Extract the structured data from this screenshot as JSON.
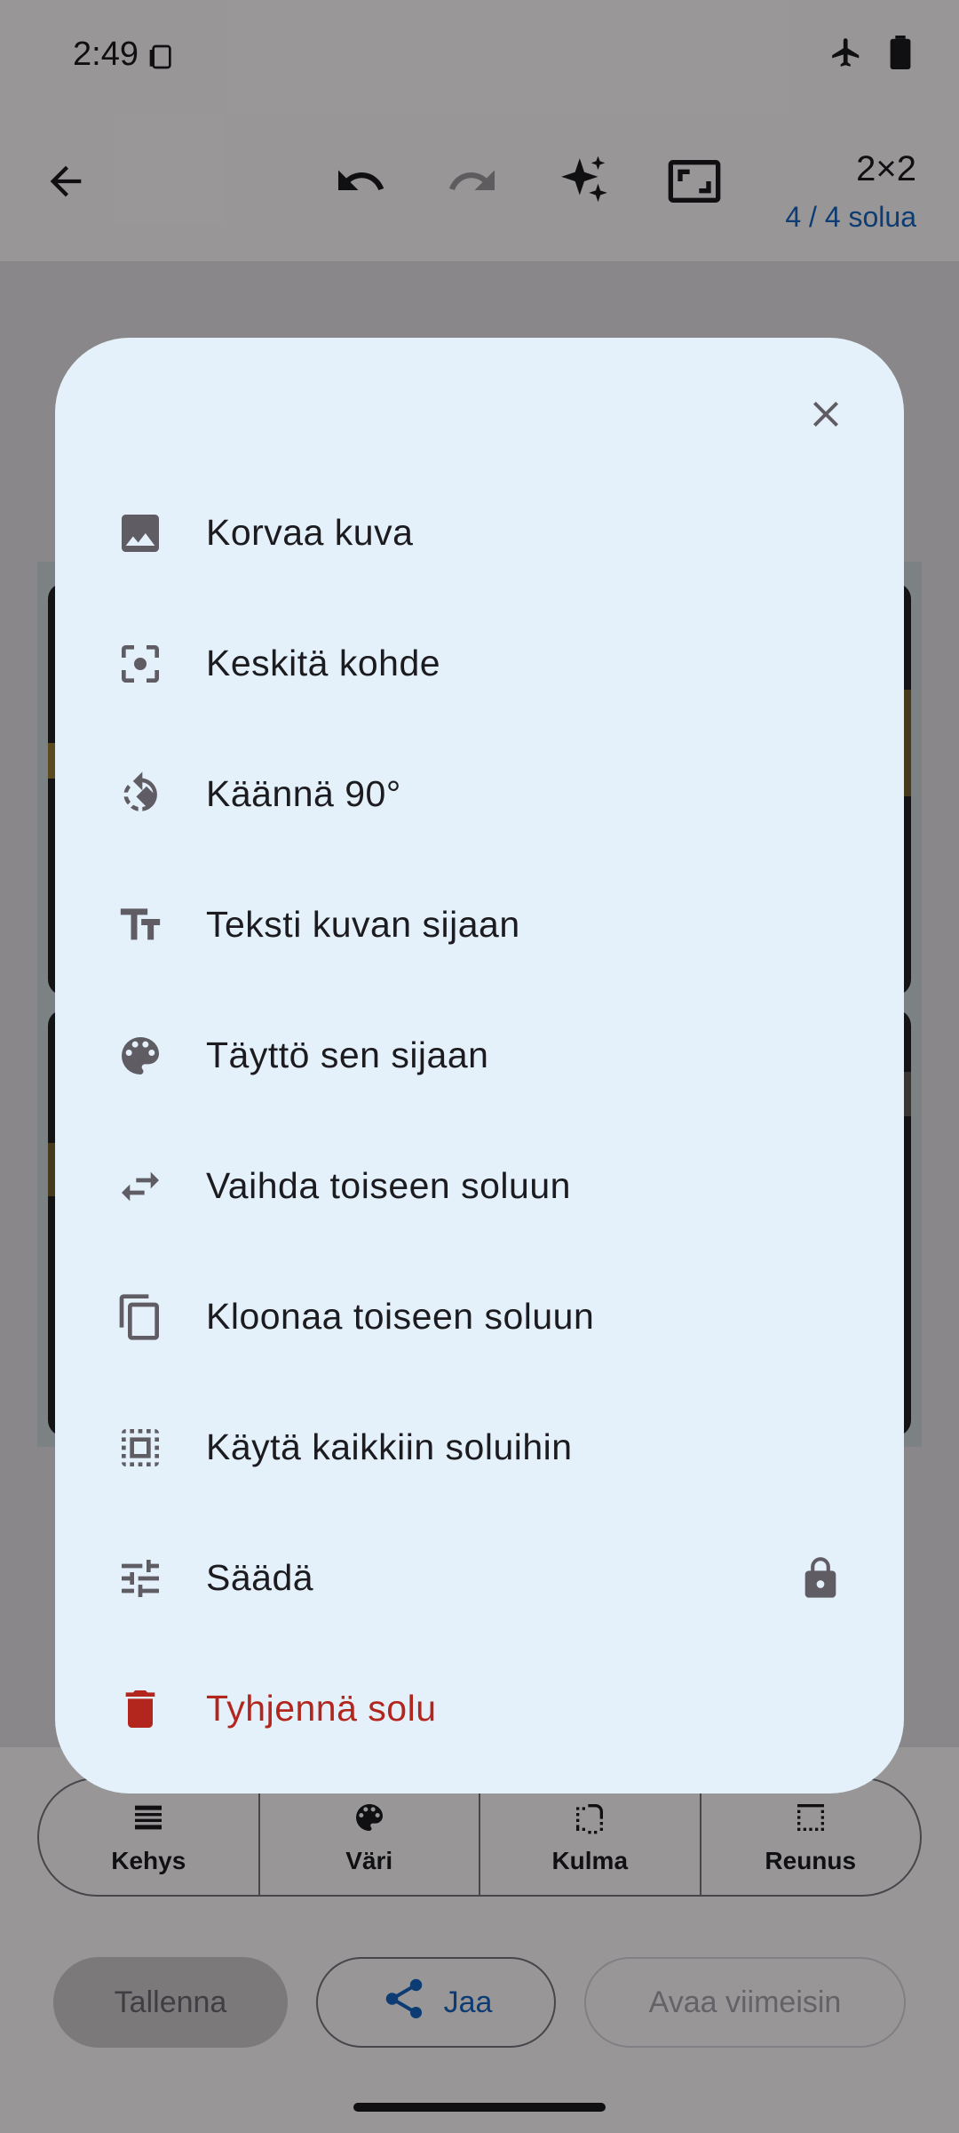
{
  "status_bar": {
    "time": "2:49"
  },
  "toolbar": {
    "grid_size": "2×2",
    "cell_count": "4 / 4 solua"
  },
  "dialog": {
    "items": [
      {
        "label": "Korvaa kuva",
        "icon": "image-icon"
      },
      {
        "label": "Keskitä kohde",
        "icon": "center-focus-icon"
      },
      {
        "label": "Käännä 90°",
        "icon": "rotate-icon"
      },
      {
        "label": "Teksti kuvan sijaan",
        "icon": "text-icon"
      },
      {
        "label": "Täyttö sen sijaan",
        "icon": "palette-icon"
      },
      {
        "label": "Vaihda toiseen soluun",
        "icon": "swap-icon"
      },
      {
        "label": "Kloonaa toiseen soluun",
        "icon": "copy-icon"
      },
      {
        "label": "Käytä kaikkiin soluihin",
        "icon": "select-all-icon"
      },
      {
        "label": "Säädä",
        "icon": "tune-icon",
        "locked": true
      },
      {
        "label": "Tyhjennä solu",
        "icon": "delete-icon",
        "danger": true
      }
    ]
  },
  "tabs": [
    {
      "label": "Kehys",
      "icon": "frame-icon"
    },
    {
      "label": "Väri",
      "icon": "palette-icon"
    },
    {
      "label": "Kulma",
      "icon": "corner-icon"
    },
    {
      "label": "Reunus",
      "icon": "border-icon"
    }
  ],
  "actions": {
    "save": "Tallenna",
    "share": "Jaa",
    "open_recent": "Avaa viimeisin"
  },
  "colors": {
    "dialog_bg": "#e4f1fb",
    "accent": "#1565c0",
    "danger": "#b3261e"
  }
}
